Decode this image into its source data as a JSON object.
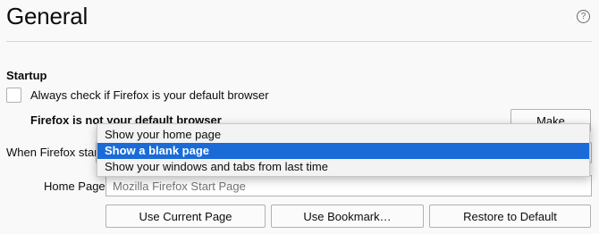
{
  "header": {
    "title": "General",
    "help_icon": "question-circle-icon",
    "help_glyph": "?"
  },
  "startup": {
    "heading": "Startup",
    "default_check_label": "Always check if Firefox is your default browser",
    "default_check_checked": false,
    "default_status": "Firefox is not your default browser",
    "make_default_label": "Make Default",
    "when_starts_label": "When Firefox starts:",
    "select_arrow": "▾",
    "options": [
      {
        "label": "Show your home page",
        "selected": false
      },
      {
        "label": "Show a blank page",
        "selected": true
      },
      {
        "label": "Show your windows and tabs from last time",
        "selected": false
      }
    ]
  },
  "homepage": {
    "label": "Home Page:",
    "placeholder": "Mozilla Firefox Start Page",
    "value": ""
  },
  "buttons": {
    "use_current": "Use Current Page",
    "use_bookmark": "Use Bookmark…",
    "restore_default": "Restore to Default"
  },
  "colors": {
    "selection_highlight": "#1a6bd8",
    "background": "#f9f9fa"
  }
}
